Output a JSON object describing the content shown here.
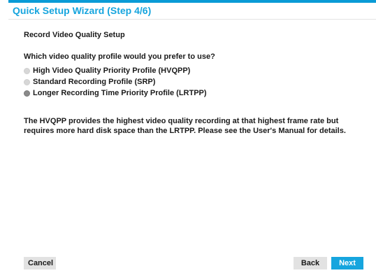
{
  "window": {
    "title": "Quick Setup Wizard (Step 4/6)"
  },
  "content": {
    "section_title": "Record Video Quality Setup",
    "question": "Which video quality profile would you prefer to use?",
    "options": [
      {
        "label": "High Video Quality Priority Profile (HVQPP)",
        "selected": false
      },
      {
        "label": "Standard Recording Profile (SRP)",
        "selected": false
      },
      {
        "label": "Longer Recording Time Priority Profile (LRTPP)",
        "selected": true
      }
    ],
    "description": "The HVQPP provides the highest video quality recording at that highest frame rate but requires more hard disk space than the LRTPP. Please see the User's Manual for details."
  },
  "footer": {
    "cancel_label": "Cancel",
    "back_label": "Back",
    "next_label": "Next"
  },
  "colors": {
    "accent": "#16a5de",
    "button_gray": "#e2e2e2",
    "radio_unselected": "#d7d7d7",
    "radio_selected": "#8a8a8a"
  }
}
